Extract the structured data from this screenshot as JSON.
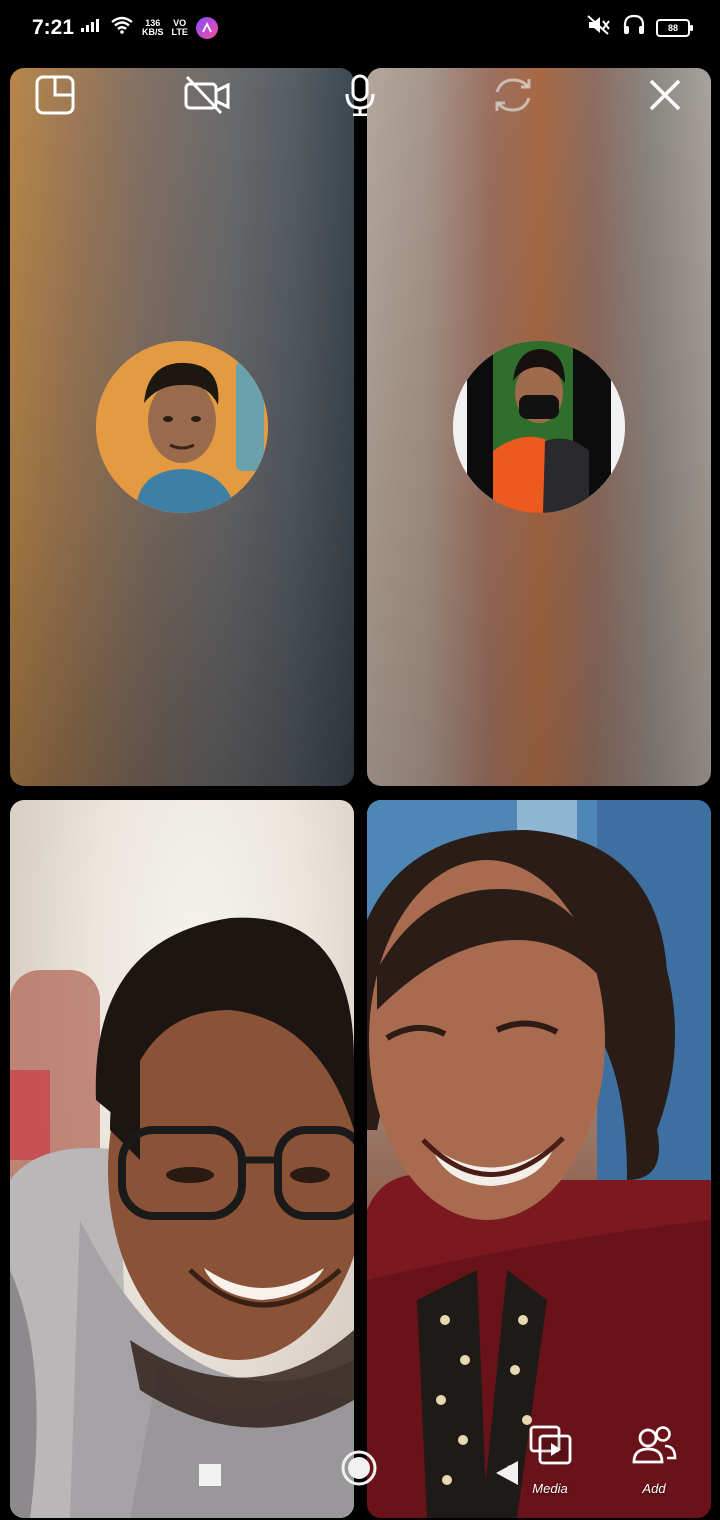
{
  "status_bar": {
    "time": "7:21",
    "net_speed": "136",
    "net_speed_unit": "KB/S",
    "volte_top": "VO",
    "volte_bottom": "LTE",
    "battery_level": "88"
  },
  "call_controls": {
    "layout_icon": "layout-icon",
    "camera_off_icon": "camera-off-icon",
    "microphone_icon": "microphone-icon",
    "switch_camera_icon": "switch-camera-icon",
    "close_icon": "close-icon"
  },
  "participants": [
    {
      "position": "top-left",
      "video": "off",
      "accent": "#e59a3c"
    },
    {
      "position": "top-right",
      "video": "off",
      "accent": "#e85a2a"
    },
    {
      "position": "bottom-left",
      "video": "on"
    },
    {
      "position": "bottom-right",
      "video": "on"
    }
  ],
  "actions": {
    "media_label": "Media",
    "add_label": "Add"
  },
  "navigation": {
    "recents_icon": "square-icon",
    "home_icon": "circle-icon",
    "back_icon": "triangle-back-icon"
  }
}
